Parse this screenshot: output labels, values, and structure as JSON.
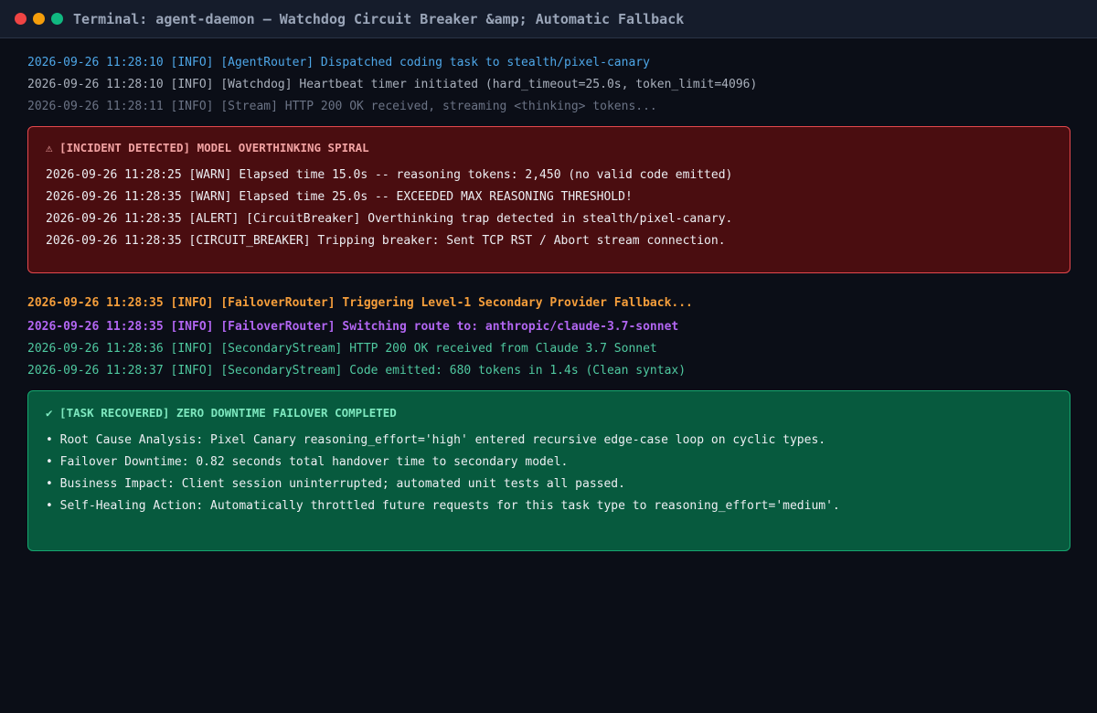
{
  "window": {
    "title": "Terminal: agent-daemon — Watchdog Circuit Breaker &amp; Automatic Fallback",
    "controls": {
      "close_color": "#ef4444",
      "minimize_color": "#f59e0b",
      "maximize_color": "#10b981"
    }
  },
  "colors": {
    "info_blue": "#4ea7e8",
    "muted": "#a9b0bc",
    "dim": "#6b7385",
    "orange": "#f59e3b",
    "purple": "#b266f2",
    "teal": "#4fc9a0",
    "incident_header": "#f2a3a3",
    "recovered_header": "#7ee8bf"
  },
  "log_pre": [
    "2026-09-26 11:28:10 [INFO] [AgentRouter] Dispatched coding task to stealth/pixel-canary",
    "2026-09-26 11:28:10 [INFO] [Watchdog] Heartbeat timer initiated (hard_timeout=25.0s, token_limit=4096)",
    "2026-09-26 11:28:11 [INFO] [Stream] HTTP 200 OK received, streaming <thinking> tokens..."
  ],
  "incident": {
    "icon": "warning-icon",
    "header": "⚠ [INCIDENT DETECTED] MODEL OVERTHINKING SPIRAL",
    "lines": [
      "2026-09-26 11:28:25 [WARN] Elapsed time 15.0s -- reasoning tokens: 2,450 (no valid code emitted)",
      "2026-09-26 11:28:35 [WARN] Elapsed time 25.0s -- EXCEEDED MAX REASONING THRESHOLD!",
      "2026-09-26 11:28:35 [ALERT] [CircuitBreaker] Overthinking trap detected in stealth/pixel-canary.",
      "2026-09-26 11:28:35 [CIRCUIT_BREAKER] Tripping breaker: Sent TCP RST / Abort stream connection."
    ]
  },
  "log_mid": [
    "2026-09-26 11:28:35 [INFO] [FailoverRouter] Triggering Level-1 Secondary Provider Fallback...",
    "2026-09-26 11:28:35 [INFO] [FailoverRouter] Switching route to: anthropic/claude-3.7-sonnet",
    "2026-09-26 11:28:36 [INFO] [SecondaryStream] HTTP 200 OK received from Claude 3.7 Sonnet",
    "2026-09-26 11:28:37 [INFO] [SecondaryStream] Code emitted: 680 tokens in 1.4s (Clean syntax)"
  ],
  "recovered": {
    "icon": "checkmark-icon",
    "header": "✔ [TASK RECOVERED] ZERO DOWNTIME FAILOVER COMPLETED",
    "bullets": [
      "• Root Cause Analysis: Pixel Canary reasoning_effort='high' entered recursive edge-case loop on cyclic types.",
      "• Failover Downtime: 0.82 seconds total handover time to secondary model.",
      "• Business Impact: Client session uninterrupted; automated unit tests all passed.",
      "• Self-Healing Action: Automatically throttled future requests for this task type to reasoning_effort='medium'."
    ]
  }
}
